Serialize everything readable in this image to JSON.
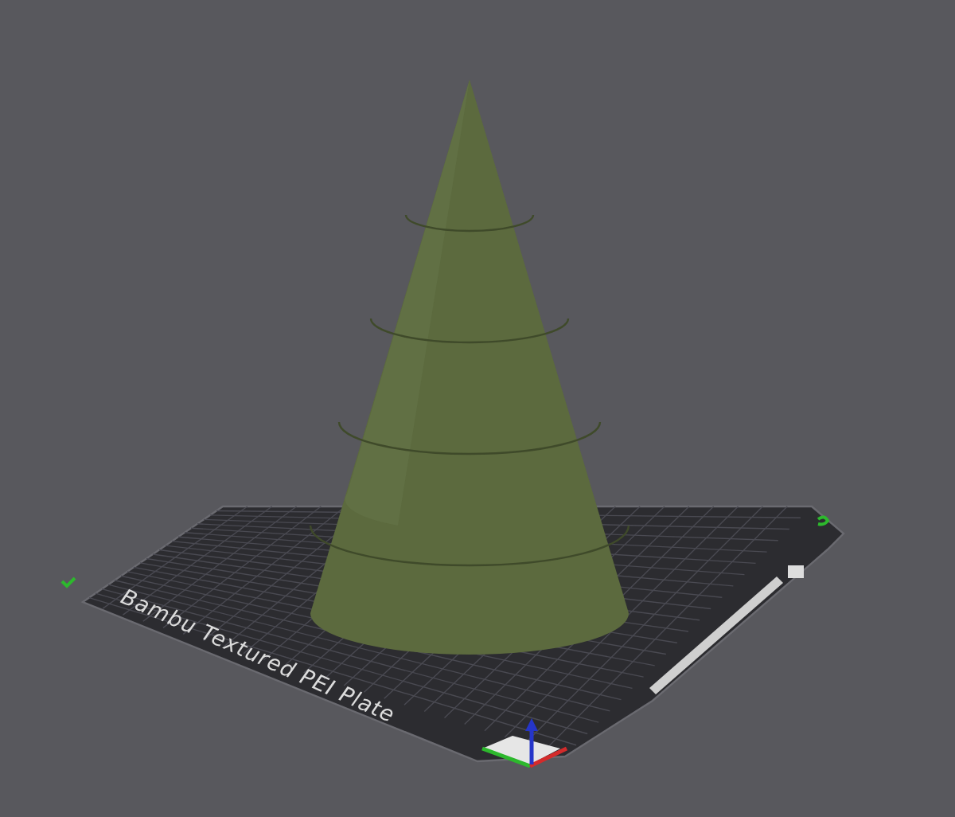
{
  "viewport": {
    "plate": {
      "label": "Bambu Textured PEI Plate"
    }
  }
}
